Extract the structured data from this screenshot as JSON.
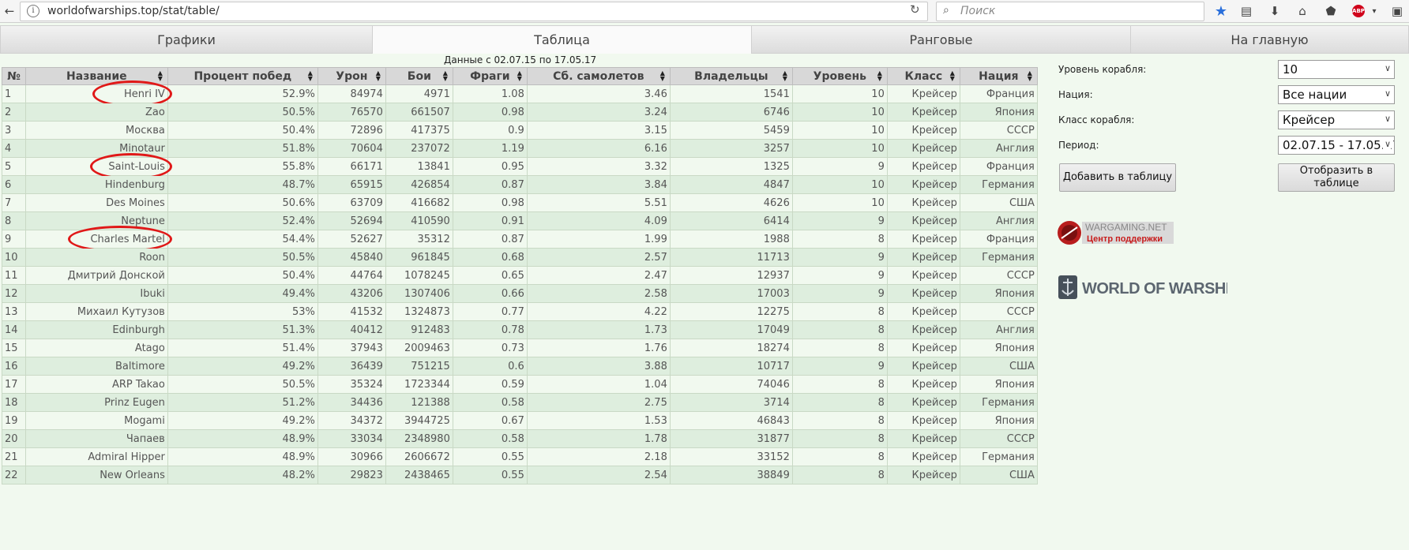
{
  "browser": {
    "url": "worldofwarships.top/stat/table/",
    "search_placeholder": "Поиск",
    "abp_label": "ABP"
  },
  "tabs": [
    {
      "label": "Графики",
      "active": false
    },
    {
      "label": "Таблица",
      "active": true
    },
    {
      "label": "Ранговые",
      "active": false
    },
    {
      "label": "На главную",
      "active": false
    }
  ],
  "date_note": "Данные с 02.07.15 по 17.05.17",
  "table": {
    "columns": [
      "№",
      "Название",
      "Процент побед",
      "Урон",
      "Бои",
      "Фраги",
      "Сб. самолетов",
      "Владельцы",
      "Уровень",
      "Класс",
      "Нация"
    ],
    "rows": [
      [
        "1",
        "Henri IV",
        "52.9%",
        "84974",
        "4971",
        "1.08",
        "3.46",
        "1541",
        "10",
        "Крейсер",
        "Франция"
      ],
      [
        "2",
        "Zao",
        "50.5%",
        "76570",
        "661507",
        "0.98",
        "3.24",
        "6746",
        "10",
        "Крейсер",
        "Япония"
      ],
      [
        "3",
        "Москва",
        "50.4%",
        "72896",
        "417375",
        "0.9",
        "3.15",
        "5459",
        "10",
        "Крейсер",
        "СССР"
      ],
      [
        "4",
        "Minotaur",
        "51.8%",
        "70604",
        "237072",
        "1.19",
        "6.16",
        "3257",
        "10",
        "Крейсер",
        "Англия"
      ],
      [
        "5",
        "Saint-Louis",
        "55.8%",
        "66171",
        "13841",
        "0.95",
        "3.32",
        "1325",
        "9",
        "Крейсер",
        "Франция"
      ],
      [
        "6",
        "Hindenburg",
        "48.7%",
        "65915",
        "426854",
        "0.87",
        "3.84",
        "4847",
        "10",
        "Крейсер",
        "Германия"
      ],
      [
        "7",
        "Des Moines",
        "50.6%",
        "63709",
        "416682",
        "0.98",
        "5.51",
        "4626",
        "10",
        "Крейсер",
        "США"
      ],
      [
        "8",
        "Neptune",
        "52.4%",
        "52694",
        "410590",
        "0.91",
        "4.09",
        "6414",
        "9",
        "Крейсер",
        "Англия"
      ],
      [
        "9",
        "Charles Martel",
        "54.4%",
        "52627",
        "35312",
        "0.87",
        "1.99",
        "1988",
        "8",
        "Крейсер",
        "Франция"
      ],
      [
        "10",
        "Roon",
        "50.5%",
        "45840",
        "961845",
        "0.68",
        "2.57",
        "11713",
        "9",
        "Крейсер",
        "Германия"
      ],
      [
        "11",
        "Дмитрий Донской",
        "50.4%",
        "44764",
        "1078245",
        "0.65",
        "2.47",
        "12937",
        "9",
        "Крейсер",
        "СССР"
      ],
      [
        "12",
        "Ibuki",
        "49.4%",
        "43206",
        "1307406",
        "0.66",
        "2.58",
        "17003",
        "9",
        "Крейсер",
        "Япония"
      ],
      [
        "13",
        "Михаил Кутузов",
        "53%",
        "41532",
        "1324873",
        "0.77",
        "4.22",
        "12275",
        "8",
        "Крейсер",
        "СССР"
      ],
      [
        "14",
        "Edinburgh",
        "51.3%",
        "40412",
        "912483",
        "0.78",
        "1.73",
        "17049",
        "8",
        "Крейсер",
        "Англия"
      ],
      [
        "15",
        "Atago",
        "51.4%",
        "37943",
        "2009463",
        "0.73",
        "1.76",
        "18274",
        "8",
        "Крейсер",
        "Япония"
      ],
      [
        "16",
        "Baltimore",
        "49.2%",
        "36439",
        "751215",
        "0.6",
        "3.88",
        "10717",
        "9",
        "Крейсер",
        "США"
      ],
      [
        "17",
        "ARP Takao",
        "50.5%",
        "35324",
        "1723344",
        "0.59",
        "1.04",
        "74046",
        "8",
        "Крейсер",
        "Япония"
      ],
      [
        "18",
        "Prinz Eugen",
        "51.2%",
        "34436",
        "121388",
        "0.58",
        "2.75",
        "3714",
        "8",
        "Крейсер",
        "Германия"
      ],
      [
        "19",
        "Mogami",
        "49.2%",
        "34372",
        "3944725",
        "0.67",
        "1.53",
        "46843",
        "8",
        "Крейсер",
        "Япония"
      ],
      [
        "20",
        "Чапаев",
        "48.9%",
        "33034",
        "2348980",
        "0.58",
        "1.78",
        "31877",
        "8",
        "Крейсер",
        "СССР"
      ],
      [
        "21",
        "Admiral Hipper",
        "48.9%",
        "30966",
        "2606672",
        "0.55",
        "2.18",
        "33152",
        "8",
        "Крейсер",
        "Германия"
      ],
      [
        "22",
        "New Orleans",
        "48.2%",
        "29823",
        "2438465",
        "0.55",
        "2.54",
        "38849",
        "8",
        "Крейсер",
        "США"
      ]
    ]
  },
  "filters": {
    "ship_level_label": "Уровень корабля:",
    "ship_level_value": "10",
    "nation_label": "Нация:",
    "nation_value": "Все нации",
    "ship_class_label": "Класс корабля:",
    "ship_class_value": "Крейсер",
    "period_label": "Период:",
    "period_value": "02.07.15 - 17.05.17"
  },
  "buttons": {
    "add_to_table": "Добавить в таблицу",
    "show_in_table": "Отобразить в таблице"
  },
  "logos": {
    "wargaming_line1": "WARGAMING.NET",
    "wargaming_line2": "Центр поддержки",
    "wows": "WORLD OF WARSHIPS"
  },
  "colors": {
    "page_bg": "#f1f9ef",
    "row_alt": "#deeede",
    "highlight_circle": "#e01818"
  }
}
